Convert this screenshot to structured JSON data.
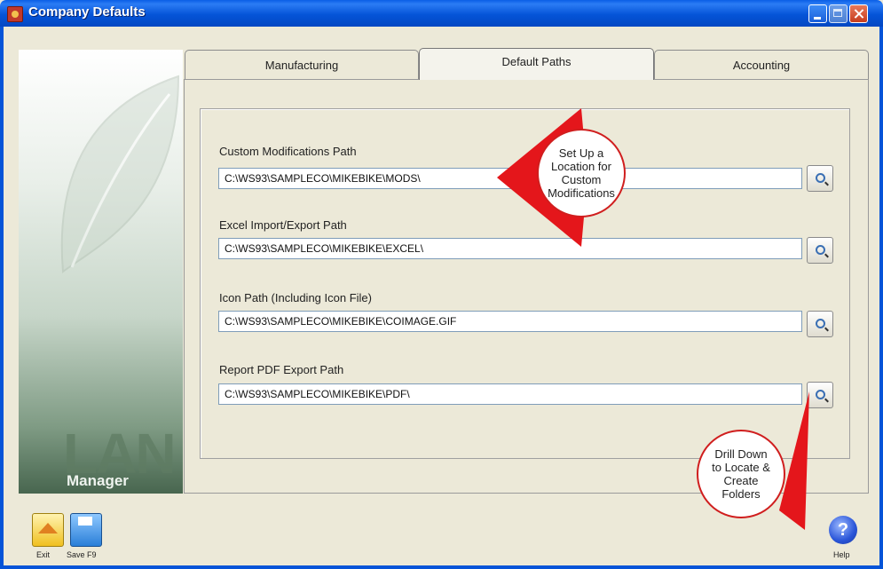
{
  "window": {
    "title": "Company Defaults",
    "colors": {
      "titlebar": "#0554d8",
      "accent_red": "#d01e1e"
    }
  },
  "sidebar": {
    "brand_logo_text": "LAN",
    "brand_subtext": "Manager"
  },
  "tabs": [
    {
      "label": "Manufacturing",
      "selected": false
    },
    {
      "label": "Default Paths",
      "selected": true
    },
    {
      "label": "Accounting",
      "selected": false
    }
  ],
  "fields": [
    {
      "label": "Custom Modifications Path",
      "value": "C:\\WS93\\SAMPLECO\\MIKEBIKE\\MODS\\"
    },
    {
      "label": "Excel Import/Export Path",
      "value": "C:\\WS93\\SAMPLECO\\MIKEBIKE\\EXCEL\\"
    },
    {
      "label": "Icon Path (Including Icon File)",
      "value": "C:\\WS93\\SAMPLECO\\MIKEBIKE\\COIMAGE.GIF"
    },
    {
      "label": "Report PDF Export Path",
      "value": "C:\\WS93\\SAMPLECO\\MIKEBIKE\\PDF\\"
    }
  ],
  "browse_icon": "magnifier-icon",
  "callouts": {
    "top": "Set Up a\nLocation for\nCustom\nModifications",
    "bottom": "Drill Down\nto Locate &\nCreate\nFolders"
  },
  "footer": {
    "exit_label": "Exit",
    "save_label": "Save F9",
    "help_label": "Help",
    "help_glyph": "?"
  }
}
